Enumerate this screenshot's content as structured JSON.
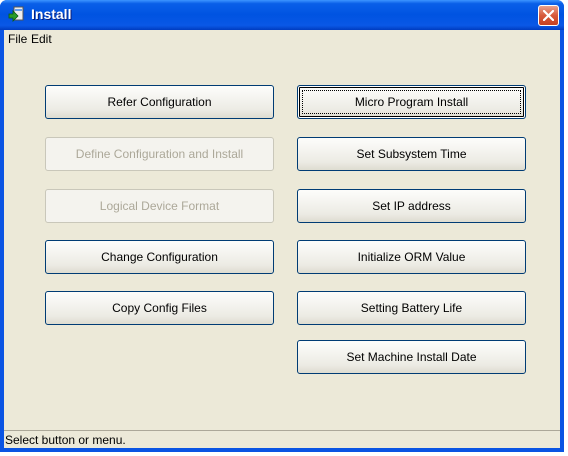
{
  "window": {
    "title": "Install"
  },
  "menu": {
    "items": [
      "File",
      "Edit"
    ]
  },
  "buttons": {
    "left": [
      {
        "label": "Refer Configuration",
        "enabled": true
      },
      {
        "label": "Define Configuration and Install",
        "enabled": false
      },
      {
        "label": "Logical Device Format",
        "enabled": false
      },
      {
        "label": "Change Configuration",
        "enabled": true
      },
      {
        "label": "Copy Config Files",
        "enabled": true
      }
    ],
    "right": [
      {
        "label": "Micro Program Install",
        "enabled": true,
        "focused": true
      },
      {
        "label": "Set Subsystem Time",
        "enabled": true
      },
      {
        "label": "Set IP address",
        "enabled": true
      },
      {
        "label": "Initialize ORM Value",
        "enabled": true
      },
      {
        "label": "Setting Battery Life",
        "enabled": true
      },
      {
        "label": "Set Machine Install Date",
        "enabled": true
      }
    ]
  },
  "status": {
    "text": "Select button or menu."
  }
}
